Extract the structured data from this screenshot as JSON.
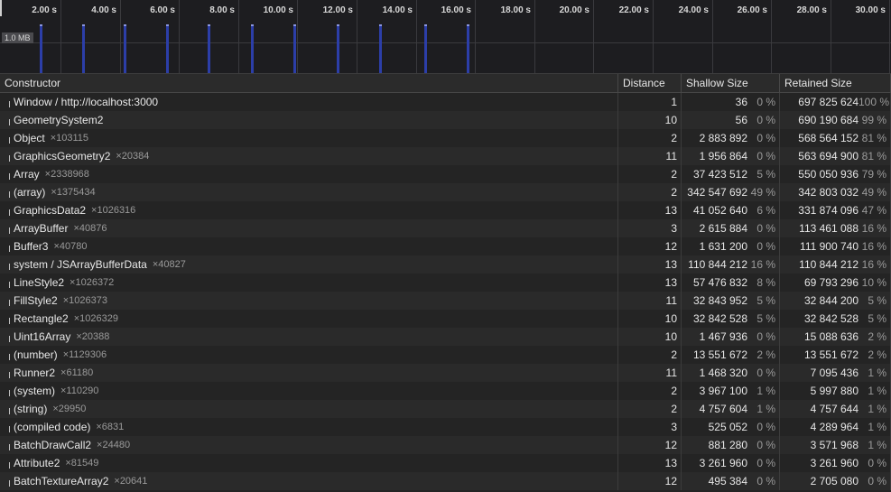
{
  "timeline": {
    "memory_label": "1.0 MB",
    "ticks": [
      "2.00 s",
      "4.00 s",
      "6.00 s",
      "8.00 s",
      "10.00 s",
      "12.00 s",
      "14.00 s",
      "16.00 s",
      "18.00 s",
      "20.00 s",
      "22.00 s",
      "24.00 s",
      "26.00 s",
      "28.00 s",
      "30.00 s"
    ],
    "alloc_bar_color": "#2c3ea8"
  },
  "table": {
    "columns": {
      "constructor": "Constructor",
      "distance": "Distance",
      "shallow": "Shallow Size",
      "retained": "Retained Size"
    },
    "rows": [
      {
        "name": "Window / http://localhost:3000",
        "count": "",
        "distance": "1",
        "shallow": "36",
        "shallow_pct": "0 %",
        "retained": "697 825 624",
        "retained_pct": "100 %"
      },
      {
        "name": "GeometrySystem2",
        "count": "",
        "distance": "10",
        "shallow": "56",
        "shallow_pct": "0 %",
        "retained": "690 190 684",
        "retained_pct": "99 %"
      },
      {
        "name": "Object",
        "count": "×103115",
        "distance": "2",
        "shallow": "2 883 892",
        "shallow_pct": "0 %",
        "retained": "568 564 152",
        "retained_pct": "81 %"
      },
      {
        "name": "GraphicsGeometry2",
        "count": "×20384",
        "distance": "11",
        "shallow": "1 956 864",
        "shallow_pct": "0 %",
        "retained": "563 694 900",
        "retained_pct": "81 %"
      },
      {
        "name": "Array",
        "count": "×2338968",
        "distance": "2",
        "shallow": "37 423 512",
        "shallow_pct": "5 %",
        "retained": "550 050 936",
        "retained_pct": "79 %"
      },
      {
        "name": "(array)",
        "count": "×1375434",
        "distance": "2",
        "shallow": "342 547 692",
        "shallow_pct": "49 %",
        "retained": "342 803 032",
        "retained_pct": "49 %"
      },
      {
        "name": "GraphicsData2",
        "count": "×1026316",
        "distance": "13",
        "shallow": "41 052 640",
        "shallow_pct": "6 %",
        "retained": "331 874 096",
        "retained_pct": "47 %"
      },
      {
        "name": "ArrayBuffer",
        "count": "×40876",
        "distance": "3",
        "shallow": "2 615 884",
        "shallow_pct": "0 %",
        "retained": "113 461 088",
        "retained_pct": "16 %"
      },
      {
        "name": "Buffer3",
        "count": "×40780",
        "distance": "12",
        "shallow": "1 631 200",
        "shallow_pct": "0 %",
        "retained": "111 900 740",
        "retained_pct": "16 %"
      },
      {
        "name": "system / JSArrayBufferData",
        "count": "×40827",
        "distance": "13",
        "shallow": "110 844 212",
        "shallow_pct": "16 %",
        "retained": "110 844 212",
        "retained_pct": "16 %"
      },
      {
        "name": "LineStyle2",
        "count": "×1026372",
        "distance": "13",
        "shallow": "57 476 832",
        "shallow_pct": "8 %",
        "retained": "69 793 296",
        "retained_pct": "10 %"
      },
      {
        "name": "FillStyle2",
        "count": "×1026373",
        "distance": "11",
        "shallow": "32 843 952",
        "shallow_pct": "5 %",
        "retained": "32 844 200",
        "retained_pct": "5 %"
      },
      {
        "name": "Rectangle2",
        "count": "×1026329",
        "distance": "10",
        "shallow": "32 842 528",
        "shallow_pct": "5 %",
        "retained": "32 842 528",
        "retained_pct": "5 %"
      },
      {
        "name": "Uint16Array",
        "count": "×20388",
        "distance": "10",
        "shallow": "1 467 936",
        "shallow_pct": "0 %",
        "retained": "15 088 636",
        "retained_pct": "2 %"
      },
      {
        "name": "(number)",
        "count": "×1129306",
        "distance": "2",
        "shallow": "13 551 672",
        "shallow_pct": "2 %",
        "retained": "13 551 672",
        "retained_pct": "2 %"
      },
      {
        "name": "Runner2",
        "count": "×61180",
        "distance": "11",
        "shallow": "1 468 320",
        "shallow_pct": "0 %",
        "retained": "7 095 436",
        "retained_pct": "1 %"
      },
      {
        "name": "(system)",
        "count": "×110290",
        "distance": "2",
        "shallow": "3 967 100",
        "shallow_pct": "1 %",
        "retained": "5 997 880",
        "retained_pct": "1 %"
      },
      {
        "name": "(string)",
        "count": "×29950",
        "distance": "2",
        "shallow": "4 757 604",
        "shallow_pct": "1 %",
        "retained": "4 757 644",
        "retained_pct": "1 %"
      },
      {
        "name": "(compiled code)",
        "count": "×6831",
        "distance": "3",
        "shallow": "525 052",
        "shallow_pct": "0 %",
        "retained": "4 289 964",
        "retained_pct": "1 %"
      },
      {
        "name": "BatchDrawCall2",
        "count": "×24480",
        "distance": "12",
        "shallow": "881 280",
        "shallow_pct": "0 %",
        "retained": "3 571 968",
        "retained_pct": "1 %"
      },
      {
        "name": "Attribute2",
        "count": "×81549",
        "distance": "13",
        "shallow": "3 261 960",
        "shallow_pct": "0 %",
        "retained": "3 261 960",
        "retained_pct": "0 %"
      },
      {
        "name": "BatchTextureArray2",
        "count": "×20641",
        "distance": "12",
        "shallow": "495 384",
        "shallow_pct": "0 %",
        "retained": "2 705 080",
        "retained_pct": "0 %"
      }
    ]
  }
}
